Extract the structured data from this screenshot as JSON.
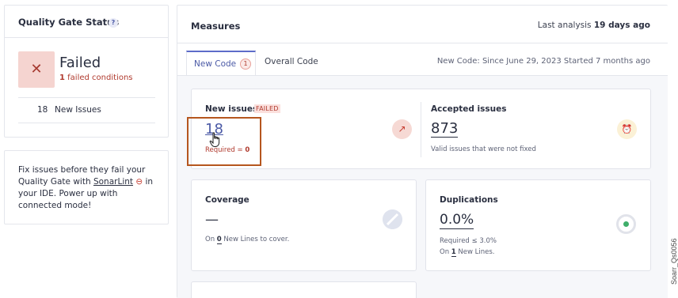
{
  "quality_gate": {
    "title": "Quality Gate Status",
    "help_glyph": "?",
    "status_glyph": "✕",
    "status": "Failed",
    "failed_count": "1",
    "failed_suffix": "failed conditions",
    "new_issues_count": "18",
    "new_issues_label": "New Issues"
  },
  "sonarlint": {
    "text_before": "Fix issues before they fail your Quality Gate with ",
    "link": "SonarLint",
    "link_icon": "⊖",
    "text_after": " in your IDE. Power up with connected mode!"
  },
  "measures": {
    "title": "Measures",
    "last_analysis_prefix": "Last analysis",
    "last_analysis_value": "19 days ago",
    "tabs": [
      {
        "label": "New Code",
        "badge": "1"
      },
      {
        "label": "Overall Code"
      }
    ],
    "new_code_info": "New Code: Since June 29, 2023  Started 7 months ago"
  },
  "new_issues": {
    "label": "New issues",
    "badge": "FAILED",
    "value": "18",
    "required_prefix": "Required = ",
    "required_value": "0",
    "icon_glyph": "↗"
  },
  "accepted_issues": {
    "label": "Accepted issues",
    "value": "873",
    "subtitle": "Valid issues that were not fixed",
    "icon_glyph": "⏰"
  },
  "coverage": {
    "label": "Coverage",
    "value": "—",
    "sub_prefix": "On ",
    "sub_count": "0",
    "sub_suffix": " New Lines to cover."
  },
  "duplications": {
    "label": "Duplications",
    "value": "0.0%",
    "required": "Required ≤ 3.0%",
    "lines_prefix": "On ",
    "lines_count": "1",
    "lines_suffix": " New Lines."
  },
  "watermark": "Soarr_Qs0056",
  "colors": {
    "accent": "#5d6cc9",
    "error": "#b03a2e",
    "success": "#3fae6a",
    "highlight_box": "#b5561e"
  }
}
